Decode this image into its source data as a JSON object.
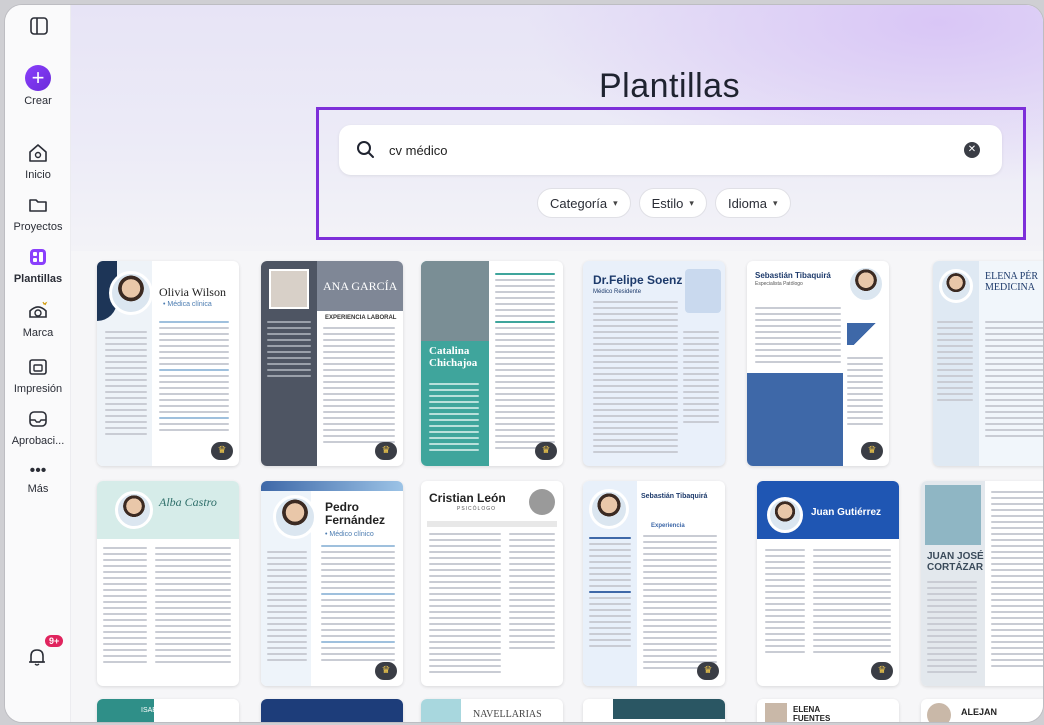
{
  "sidebar": {
    "items": [
      {
        "label": "Crear"
      },
      {
        "label": "Inicio"
      },
      {
        "label": "Proyectos"
      },
      {
        "label": "Plantillas"
      },
      {
        "label": "Marca"
      },
      {
        "label": "Impresión"
      },
      {
        "label": "Aprobaci..."
      },
      {
        "label": "Más"
      }
    ],
    "notifications_badge": "9+"
  },
  "header": {
    "title": "Plantillas"
  },
  "search": {
    "value": "cv médico"
  },
  "filters": [
    {
      "label": "Categoría"
    },
    {
      "label": "Estilo"
    },
    {
      "label": "Idioma"
    }
  ],
  "templates": [
    {
      "name": "Olivia Wilson",
      "subtitle": "• Médica clínica"
    },
    {
      "name": "ANA GARCÍA",
      "subtitle": "EXPERIENCIA LABORAL"
    },
    {
      "name": "Catalina Chichajoa",
      "subtitle": ""
    },
    {
      "name": "Dr.Felipe Soenz",
      "subtitle": "Médico Residente"
    },
    {
      "name": "Sebastián Tibaquirá",
      "subtitle": "Especialista Patólogo"
    },
    {
      "name": "ELENA PÉR MEDICINA",
      "subtitle": ""
    },
    {
      "name": "Alba Castro",
      "subtitle": ""
    },
    {
      "name": "Pedro Fernández",
      "subtitle": "• Médico clínico"
    },
    {
      "name": "Cristian León",
      "subtitle": "PSICÓLOGO"
    },
    {
      "name": "Sebastián Tibaquirá",
      "subtitle": "Experiencia"
    },
    {
      "name": "Juan Gutiérrez",
      "subtitle": ""
    },
    {
      "name": "JUAN JOSÉ CORTÁZAR",
      "subtitle": ""
    }
  ],
  "bottom_row": [
    "ISABEL",
    "NAVELLARIAS",
    "ELENA FUENTES",
    "ALEJAN"
  ],
  "colors": {
    "accent": "#7d2fd9",
    "brand_purple": "#8a3ffc"
  }
}
